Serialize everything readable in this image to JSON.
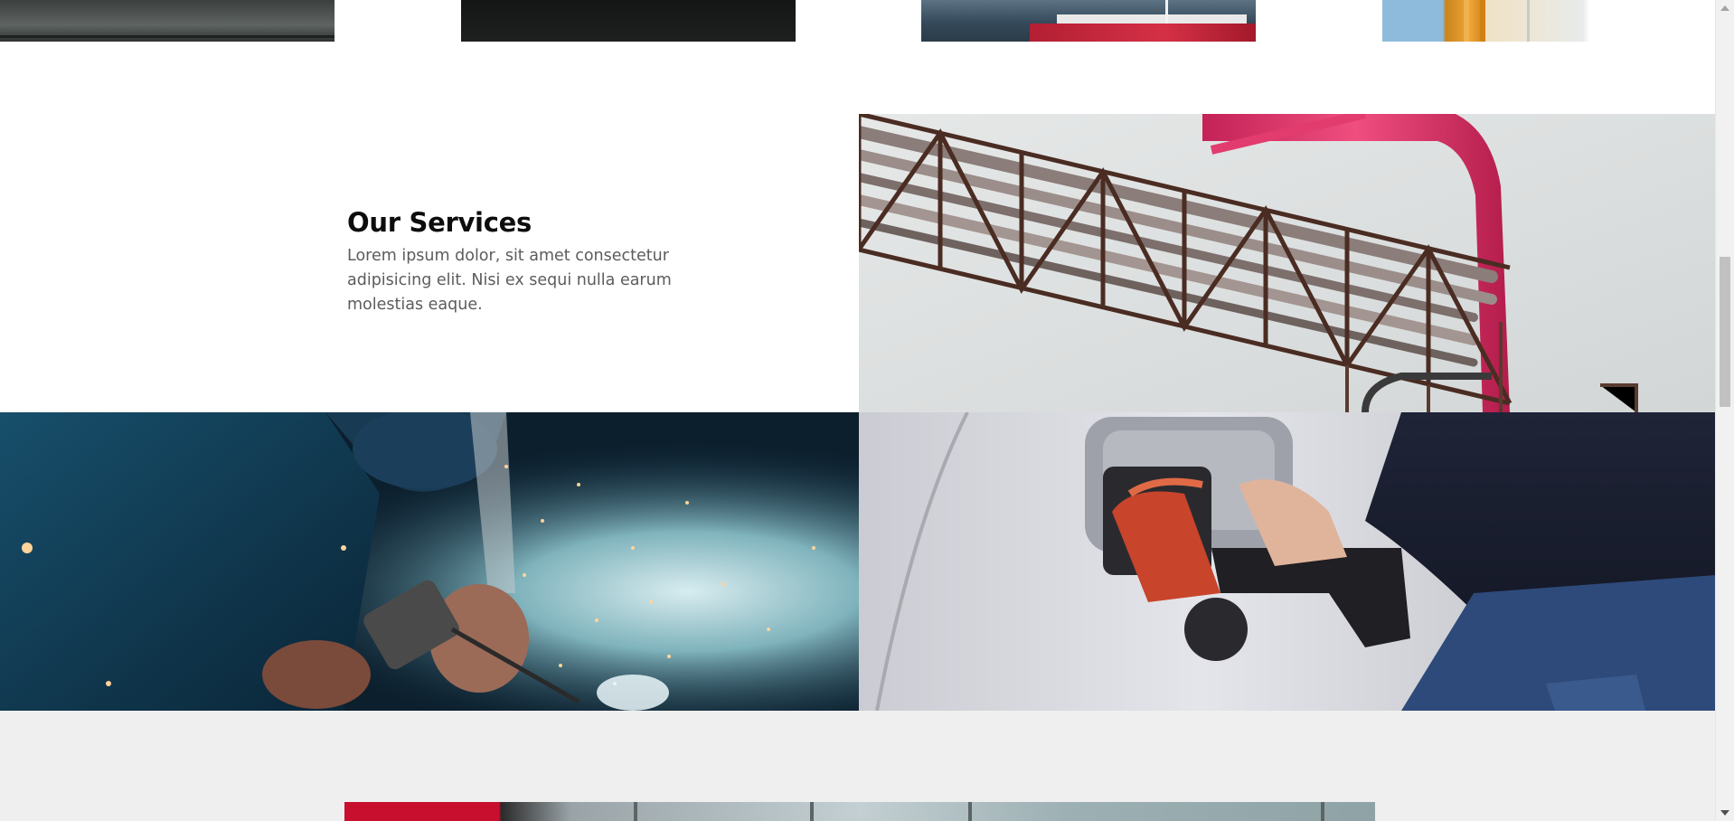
{
  "top_gallery": {
    "images": [
      {
        "name": "dock-photo"
      },
      {
        "name": "dark-photo"
      },
      {
        "name": "tanker-ship-photo"
      },
      {
        "name": "industrial-pipes-photo"
      }
    ]
  },
  "services": {
    "title": "Our Services",
    "description": "Lorem ipsum dolor, sit amet consectetur adipisicing elit. Nisi ex sequi nulla earum molestias eaque."
  },
  "tiles": [
    {
      "name": "pipeline-bridge-image"
    },
    {
      "name": "welding-image"
    },
    {
      "name": "fuel-nozzle-image"
    }
  ],
  "colors": {
    "heading": "#0d0d0d",
    "body_text": "#5c5c5c",
    "section_gray": "#efefef",
    "accent_red": "#c8102e"
  }
}
